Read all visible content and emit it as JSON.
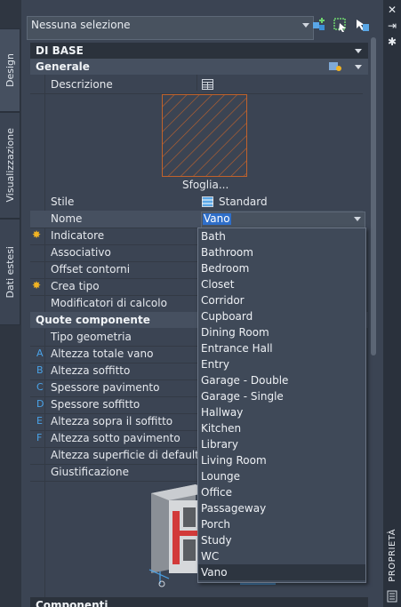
{
  "top": {
    "selection": "Nessuna selezione"
  },
  "tabs": [
    {
      "label": "Design"
    },
    {
      "label": "Visualizzazione"
    },
    {
      "label": "Dati estesi"
    }
  ],
  "palette_title": "PROPRIETÀ",
  "sections": {
    "base": "DI BASE",
    "generale": "Generale",
    "quote": "Quote componente",
    "bottom_cut": "Componenti"
  },
  "generale_rows": {
    "descrizione": "Descrizione",
    "sfoglia": "Sfoglia...",
    "stile": "Stile",
    "stile_value": "Standard",
    "nome": "Nome",
    "nome_value": "Vano",
    "indicatore": "Indicatore",
    "associativo": "Associativo",
    "offset": "Offset contorni",
    "crea_tipo": "Crea tipo",
    "modificatori": "Modificatori di calcolo"
  },
  "quote_rows": [
    {
      "key": "",
      "label": "Tipo geometria"
    },
    {
      "key": "A",
      "label": "Altezza totale vano"
    },
    {
      "key": "B",
      "label": "Altezza soffitto"
    },
    {
      "key": "C",
      "label": "Spessore pavimento"
    },
    {
      "key": "D",
      "label": "Spessore soffitto"
    },
    {
      "key": "E",
      "label": "Altezza sopra il soffitto"
    },
    {
      "key": "F",
      "label": "Altezza sotto pavimento"
    },
    {
      "key": "",
      "label": "Altezza superficie di default"
    },
    {
      "key": "",
      "label": "Giustificazione"
    }
  ],
  "dropdown_options": [
    "Bath",
    "Bathroom",
    "Bedroom",
    "Closet",
    "Corridor",
    "Cupboard",
    "Dining Room",
    "Entrance Hall",
    "Entry",
    "Garage - Double",
    "Garage - Single",
    "Hallway",
    "Kitchen",
    "Library",
    "Living Room",
    "Lounge",
    "Office",
    "Passageway",
    "Porch",
    "Study",
    "WC",
    "Vano"
  ],
  "dropdown_selected": "Vano",
  "colors": {
    "accent": "#2f6fc9",
    "star": "#f0b323",
    "key": "#4aa3e8"
  },
  "icons": [
    "quick-select-icon",
    "select-objects-icon",
    "toggle-pickadd-icon",
    "close-icon",
    "autohide-icon",
    "options-icon",
    "table-icon",
    "style-icon",
    "properties-icon"
  ]
}
